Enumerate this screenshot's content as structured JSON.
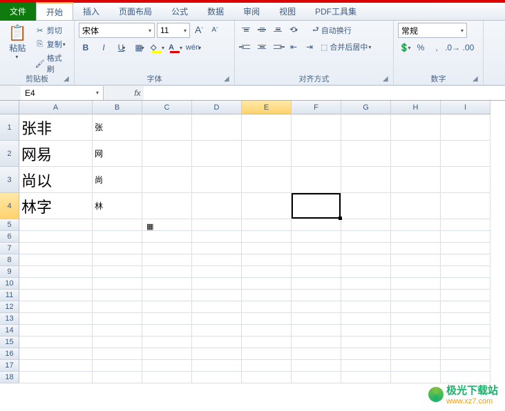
{
  "tabs": {
    "file": "文件",
    "start": "开始",
    "insert": "插入",
    "layout": "页面布局",
    "formula": "公式",
    "data": "数据",
    "review": "审阅",
    "view": "视图",
    "pdf": "PDF工具集"
  },
  "clipboard": {
    "paste": "粘贴",
    "cut": "剪切",
    "copy": "复制",
    "format_painter": "格式刷",
    "label": "剪贴板"
  },
  "font": {
    "name": "宋体",
    "size": "11",
    "label": "字体"
  },
  "alignment": {
    "wrap": "自动换行",
    "merge": "合并后居中",
    "label": "对齐方式"
  },
  "number": {
    "format": "常规",
    "label": "数字"
  },
  "namebox": "E4",
  "columns": [
    "A",
    "B",
    "C",
    "D",
    "E",
    "F",
    "G",
    "H",
    "I"
  ],
  "rows_tall": [
    1,
    2,
    3,
    4
  ],
  "rows_norm": [
    5,
    6,
    7,
    8,
    9,
    10,
    11,
    12,
    13,
    14,
    15,
    16,
    17,
    18
  ],
  "cells": {
    "A1": "张非",
    "B1": "张",
    "A2": "网易",
    "B2": "网",
    "A3": "尚以",
    "B3": "尚",
    "A4": "林字",
    "B4": "林"
  },
  "watermark": {
    "name": "极光下载站",
    "url": "www.xz7.com"
  }
}
